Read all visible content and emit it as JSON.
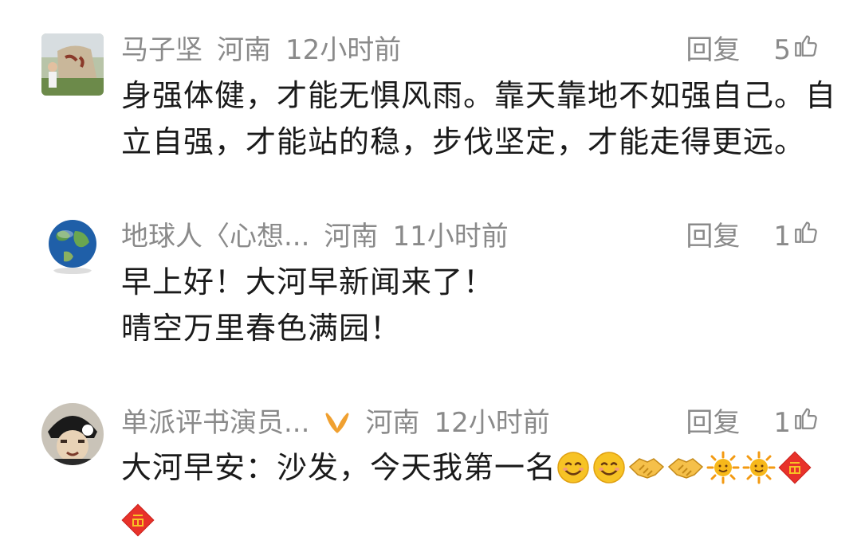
{
  "comments": [
    {
      "user": "马子坚",
      "location": "河南",
      "time": "12小时前",
      "reply": "回复",
      "likes": "5",
      "lines": [
        "身强体健，才能无惧风雨。靠天靠地不如强自己。自",
        "立自强，才能站的稳，步伐坚定，才能走得更远。"
      ]
    },
    {
      "user": "地球人〈心想...",
      "location": "河南",
      "time": "11小时前",
      "reply": "回复",
      "likes": "1",
      "lines": [
        "早上好！大河早新闻来了！",
        "晴空万里春色满园！"
      ]
    },
    {
      "user": "单派评书演员...",
      "location": "河南",
      "time": "12小时前",
      "reply": "回复",
      "likes": "1",
      "text": "大河早安：沙发，今天我第一名",
      "emojis": [
        "smile-emoji",
        "smile-emoji",
        "handshake-emoji",
        "handshake-emoji",
        "sun-emoji",
        "sun-emoji",
        "fu-emoji",
        "fu-emoji"
      ]
    }
  ],
  "colors": {
    "meta": "#8a8a8a",
    "text": "#1a1a1a",
    "badge": "#f0a030"
  }
}
